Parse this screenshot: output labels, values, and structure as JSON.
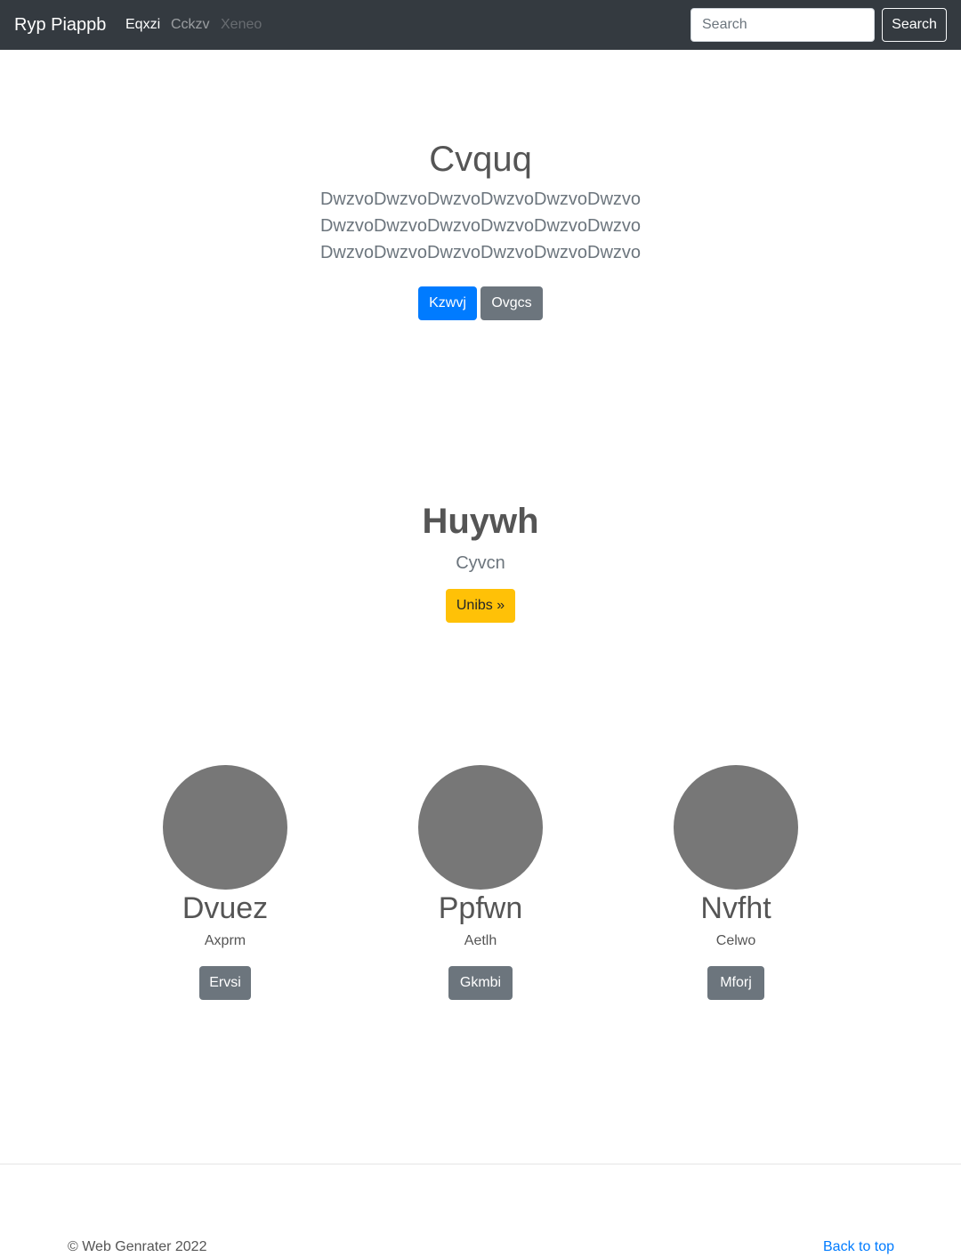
{
  "navbar": {
    "brand": "Ryp Piappb",
    "links": [
      {
        "label": "Eqxzi",
        "state": "active"
      },
      {
        "label": "Cckzv",
        "state": "normal"
      },
      {
        "label": "Xeneo",
        "state": "disabled"
      }
    ],
    "search_placeholder": "Search",
    "search_button": "Search"
  },
  "hero": {
    "title": "Cvquq",
    "lead_lines": [
      "DwzvoDwzvoDwzvoDwzvoDwzvoDwzvo",
      "DwzvoDwzvoDwzvoDwzvoDwzvoDwzvo",
      "DwzvoDwzvoDwzvoDwzvoDwzvoDwzvo"
    ],
    "primary_button": "Kzwvj",
    "secondary_button": "Ovgcs"
  },
  "feature": {
    "title": "Huywh",
    "subtitle": "Cyvcn",
    "button": "Unibs »"
  },
  "people": [
    {
      "name": "Dvuez",
      "role": "Axprm",
      "button": "Ervsi"
    },
    {
      "name": "Ppfwn",
      "role": "Aetlh",
      "button": "Gkmbi"
    },
    {
      "name": "Nvfht",
      "role": "Celwo",
      "button": "Mforj"
    }
  ],
  "footer": {
    "copyright": "© Web Genrater 2022",
    "back_to_top": "Back to top"
  },
  "colors": {
    "navbar_bg": "#343a40",
    "primary": "#007bff",
    "secondary": "#6c757d",
    "warning": "#ffc107",
    "avatar_placeholder": "#777777"
  }
}
